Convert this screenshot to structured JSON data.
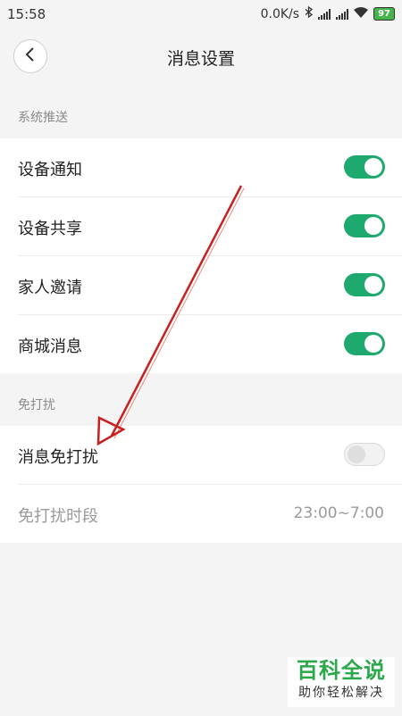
{
  "status_bar": {
    "time": "15:58",
    "network_speed": "0.0K/s",
    "battery": "97",
    "icons": [
      "bluetooth-icon",
      "signal-icon",
      "signal-icon",
      "wifi-icon",
      "battery-icon"
    ]
  },
  "header": {
    "title": "消息设置",
    "back_icon": "chevron-left-icon"
  },
  "system_push": {
    "section_label": "系统推送",
    "items": [
      {
        "label": "设备通知",
        "enabled": true
      },
      {
        "label": "设备共享",
        "enabled": true
      },
      {
        "label": "家人邀请",
        "enabled": true
      },
      {
        "label": "商城消息",
        "enabled": true
      }
    ]
  },
  "dnd": {
    "section_label": "免打扰",
    "toggle_label": "消息免打扰",
    "toggle_enabled": false,
    "period_label": "免打扰时段",
    "period_value": "23:00~7:00"
  },
  "watermark": {
    "title": "百科全说",
    "subtitle": "助你轻松解决"
  },
  "colors": {
    "toggle_on": "#1eaa6e",
    "annotation_arrow": "#c8201e",
    "watermark_green": "#2aa84a"
  }
}
